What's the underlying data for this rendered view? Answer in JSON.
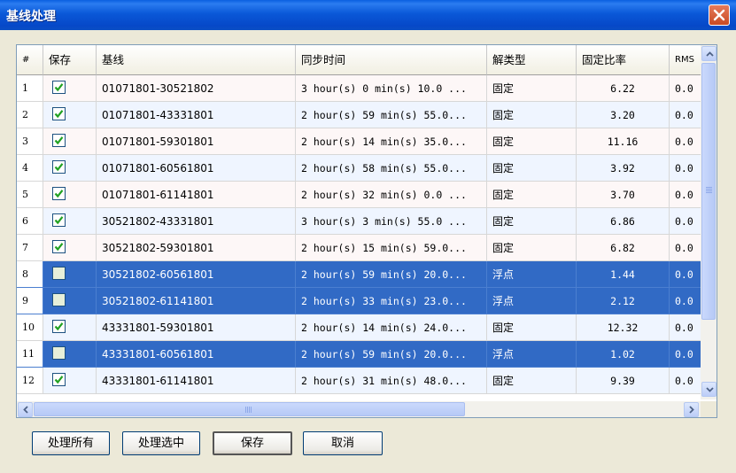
{
  "window": {
    "title": "基线处理"
  },
  "columns": [
    "#",
    "保存",
    "基线",
    "同步时间",
    "解类型",
    "固定比率",
    "RMS"
  ],
  "rows": [
    {
      "n": "1",
      "save": true,
      "baseline": "01071801-30521802",
      "time": "3 hour(s) 0 min(s) 10.0 ...",
      "type": "固定",
      "ratio": "6.22",
      "rms": "0.0",
      "selected": false
    },
    {
      "n": "2",
      "save": true,
      "baseline": "01071801-43331801",
      "time": "2 hour(s) 59 min(s) 55.0...",
      "type": "固定",
      "ratio": "3.20",
      "rms": "0.0",
      "selected": false
    },
    {
      "n": "3",
      "save": true,
      "baseline": "01071801-59301801",
      "time": "2 hour(s) 14 min(s) 35.0...",
      "type": "固定",
      "ratio": "11.16",
      "rms": "0.0",
      "selected": false
    },
    {
      "n": "4",
      "save": true,
      "baseline": "01071801-60561801",
      "time": "2 hour(s) 58 min(s) 55.0...",
      "type": "固定",
      "ratio": "3.92",
      "rms": "0.0",
      "selected": false
    },
    {
      "n": "5",
      "save": true,
      "baseline": "01071801-61141801",
      "time": "2 hour(s) 32 min(s) 0.0 ...",
      "type": "固定",
      "ratio": "3.70",
      "rms": "0.0",
      "selected": false
    },
    {
      "n": "6",
      "save": true,
      "baseline": "30521802-43331801",
      "time": "3 hour(s) 3 min(s) 55.0 ...",
      "type": "固定",
      "ratio": "6.86",
      "rms": "0.0",
      "selected": false
    },
    {
      "n": "7",
      "save": true,
      "baseline": "30521802-59301801",
      "time": "2 hour(s) 15 min(s) 59.0...",
      "type": "固定",
      "ratio": "6.82",
      "rms": "0.0",
      "selected": false
    },
    {
      "n": "8",
      "save": false,
      "baseline": "30521802-60561801",
      "time": "2 hour(s) 59 min(s) 20.0...",
      "type": "浮点",
      "ratio": "1.44",
      "rms": "0.0",
      "selected": true
    },
    {
      "n": "9",
      "save": false,
      "baseline": "30521802-61141801",
      "time": "2 hour(s) 33 min(s) 23.0...",
      "type": "浮点",
      "ratio": "2.12",
      "rms": "0.0",
      "selected": true
    },
    {
      "n": "10",
      "save": true,
      "baseline": "43331801-59301801",
      "time": "2 hour(s) 14 min(s) 24.0...",
      "type": "固定",
      "ratio": "12.32",
      "rms": "0.0",
      "selected": false
    },
    {
      "n": "11",
      "save": false,
      "baseline": "43331801-60561801",
      "time": "2 hour(s) 59 min(s) 20.0...",
      "type": "浮点",
      "ratio": "1.02",
      "rms": "0.0",
      "selected": true
    },
    {
      "n": "12",
      "save": true,
      "baseline": "43331801-61141801",
      "time": "2 hour(s) 31 min(s) 48.0...",
      "type": "固定",
      "ratio": "9.39",
      "rms": "0.0",
      "selected": false
    }
  ],
  "buttons": {
    "process_all": "处理所有",
    "process_selected": "处理选中",
    "save": "保存",
    "cancel": "取消"
  },
  "colors": {
    "titlebar": "#0a58d8",
    "selection": "#316ac5",
    "close": "#c94b24"
  },
  "icons": {
    "close": "close-icon",
    "check": "check-icon"
  }
}
